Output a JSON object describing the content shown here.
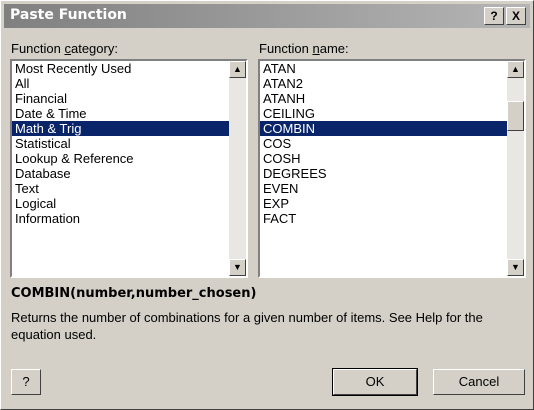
{
  "window": {
    "title": "Paste Function",
    "help_btn": "?",
    "close_btn": "X"
  },
  "category": {
    "label": "Function category:",
    "items": [
      "Most Recently Used",
      "All",
      "Financial",
      "Date & Time",
      "Math & Trig",
      "Statistical",
      "Lookup & Reference",
      "Database",
      "Text",
      "Logical",
      "Information"
    ],
    "selected": "Math & Trig"
  },
  "function": {
    "label": "Function name:",
    "items": [
      "ATAN",
      "ATAN2",
      "ATANH",
      "CEILING",
      "COMBIN",
      "COS",
      "COSH",
      "DEGREES",
      "EVEN",
      "EXP",
      "FACT"
    ],
    "selected": "COMBIN"
  },
  "syntax": "COMBIN(number,number_chosen)",
  "description": "Returns the number of combinations for a given number of items. See Help for the equation used.",
  "buttons": {
    "help_icon": "?",
    "ok": "OK",
    "cancel": "Cancel"
  },
  "icons": {
    "scroll_up": "▲",
    "scroll_down": "▼"
  }
}
